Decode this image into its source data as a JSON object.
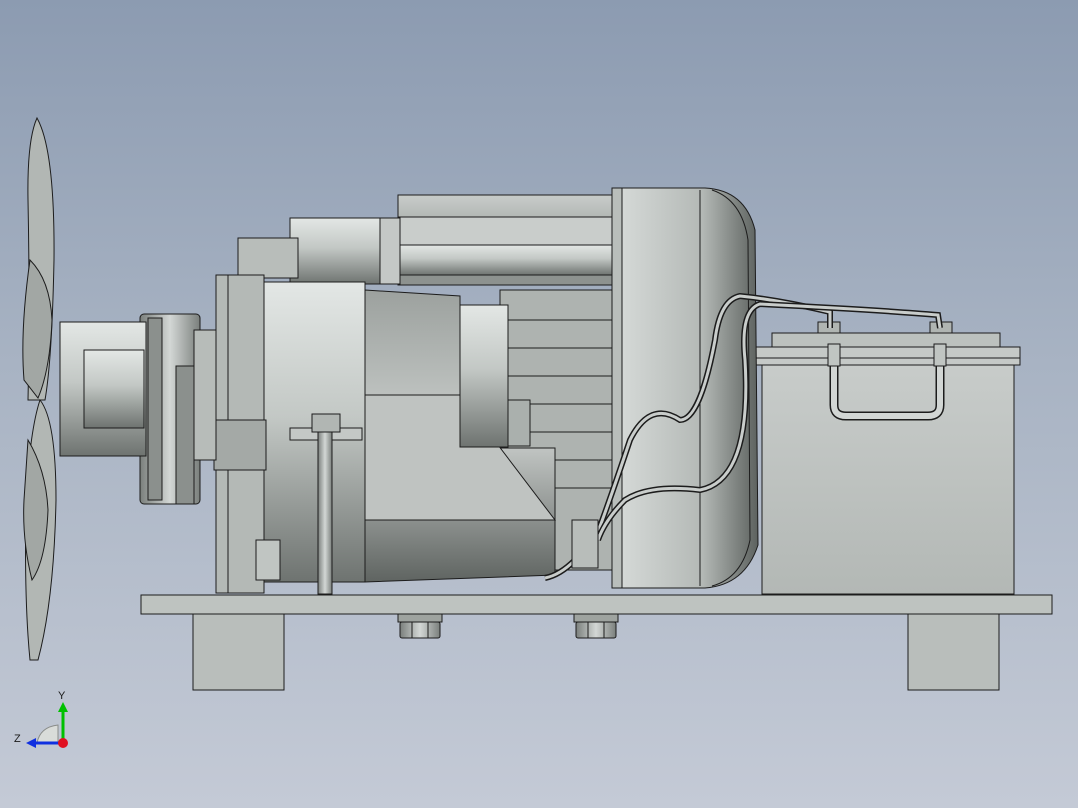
{
  "window": {
    "title": ""
  },
  "viewport": {
    "background_top": "#8c9bb1",
    "background_bottom": "#c4cad6"
  },
  "model": {
    "name": "",
    "components": [
      "fan",
      "shaft",
      "pulley",
      "alternator",
      "motor",
      "cable",
      "battery",
      "baseplate",
      "mounting-feet",
      "bolts"
    ],
    "part_color": "#bfc4c1",
    "edge_color": "#1c1c1c"
  },
  "triad": {
    "y_label": "Y",
    "z_label": "Z",
    "y_color": "#00c000",
    "z_color": "#1030e0",
    "x_color": "#e01020"
  }
}
